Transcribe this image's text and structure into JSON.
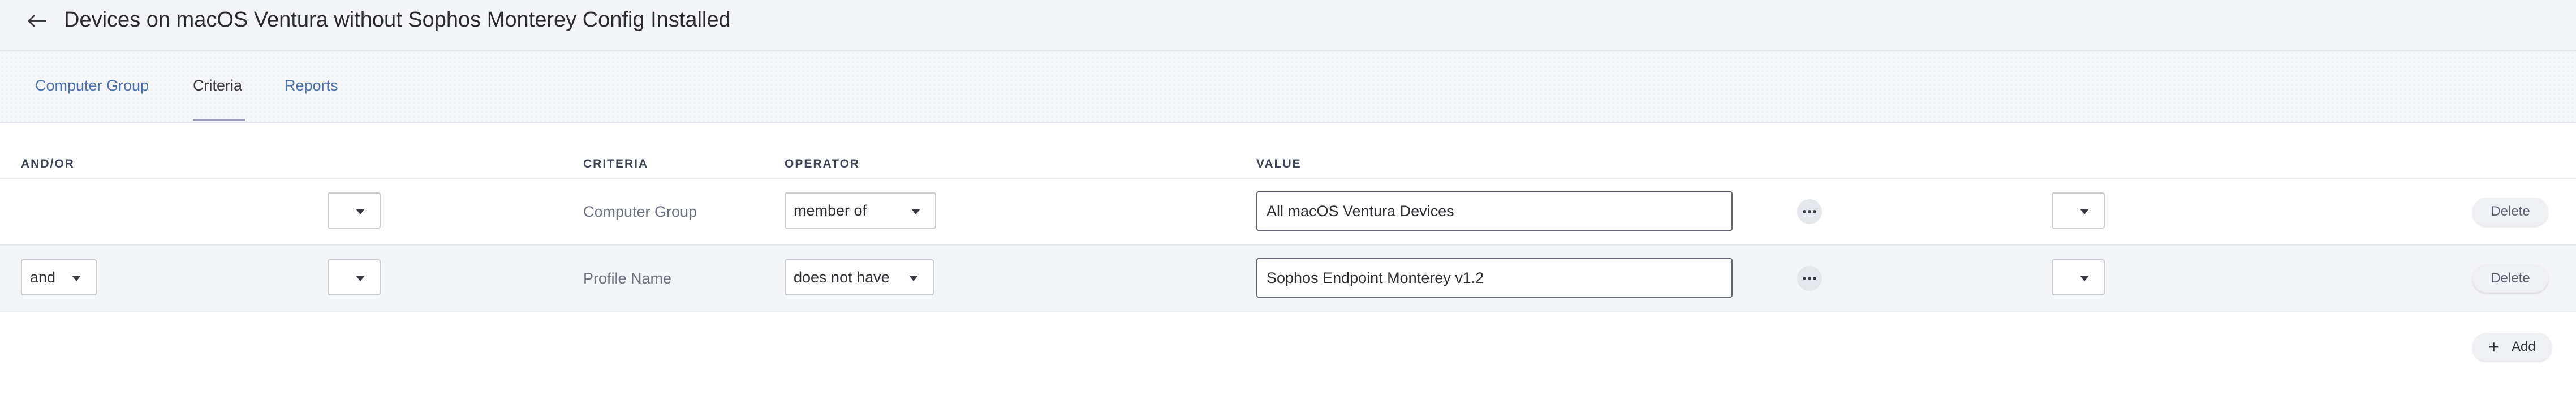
{
  "header": {
    "title": "Devices on macOS Ventura without Sophos Monterey Config Installed",
    "back_icon": "arrow-left-icon"
  },
  "tabs": [
    {
      "label": "Computer Group",
      "active": false
    },
    {
      "label": "Criteria",
      "active": true
    },
    {
      "label": "Reports",
      "active": false
    }
  ],
  "table": {
    "headers": {
      "and_or": "AND/OR",
      "criteria": "CRITERIA",
      "operator": "OPERATOR",
      "value": "VALUE"
    },
    "rows": [
      {
        "and_or": "",
        "paren_open": "",
        "criteria": "Computer Group",
        "operator": "member of",
        "value": "All macOS Ventura Devices",
        "paren_close": "",
        "delete_label": "Delete"
      },
      {
        "and_or": "and",
        "paren_open": "",
        "criteria": "Profile Name",
        "operator": "does not have",
        "value": "Sophos Endpoint Monterey v1.2",
        "paren_close": "",
        "delete_label": "Delete"
      }
    ]
  },
  "actions": {
    "add_label": "Add"
  },
  "colors": {
    "tab_link": "#4a73b3",
    "header_bg": "#f4f5f8",
    "alt_row_bg": "#f4f5f8"
  }
}
